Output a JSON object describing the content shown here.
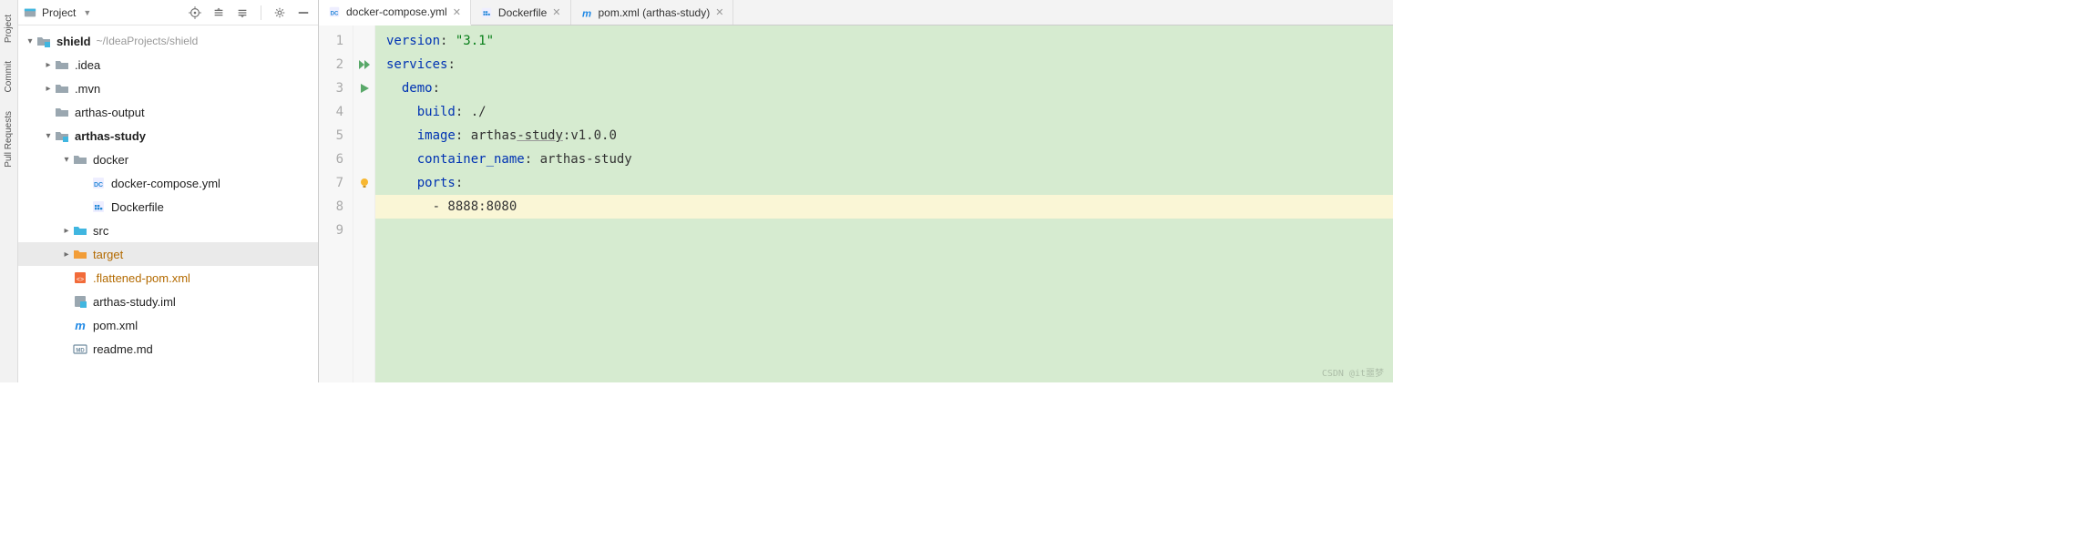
{
  "rail": {
    "top": "Project",
    "mid": "Commit",
    "bot": "Pull Requests"
  },
  "header": {
    "label": "Project"
  },
  "tree": {
    "root": {
      "name": "shield",
      "path": "~/IdeaProjects/shield"
    },
    "items": [
      {
        "name": ".idea",
        "indent": 1,
        "arrow": "right",
        "icon": "folder"
      },
      {
        "name": ".mvn",
        "indent": 1,
        "arrow": "right",
        "icon": "folder"
      },
      {
        "name": "arthas-output",
        "indent": 1,
        "arrow": "none",
        "icon": "folder"
      },
      {
        "name": "arthas-study",
        "indent": 1,
        "arrow": "down",
        "icon": "module",
        "bold": true
      },
      {
        "name": "docker",
        "indent": 2,
        "arrow": "down",
        "icon": "folder"
      },
      {
        "name": "docker-compose.yml",
        "indent": 3,
        "arrow": "none",
        "icon": "dc"
      },
      {
        "name": "Dockerfile",
        "indent": 3,
        "arrow": "none",
        "icon": "docker"
      },
      {
        "name": "src",
        "indent": 2,
        "arrow": "right",
        "icon": "src"
      },
      {
        "name": "target",
        "indent": 2,
        "arrow": "right",
        "icon": "target",
        "sel": true,
        "orange": true
      },
      {
        "name": ".flattened-pom.xml",
        "indent": 2,
        "arrow": "none",
        "icon": "xml",
        "orange": true
      },
      {
        "name": "arthas-study.iml",
        "indent": 2,
        "arrow": "none",
        "icon": "iml"
      },
      {
        "name": "pom.xml",
        "indent": 2,
        "arrow": "none",
        "icon": "maven"
      },
      {
        "name": "readme.md",
        "indent": 2,
        "arrow": "none",
        "icon": "md"
      }
    ]
  },
  "tabs": [
    {
      "label": "docker-compose.yml",
      "icon": "dc",
      "active": true
    },
    {
      "label": "Dockerfile",
      "icon": "docker"
    },
    {
      "label": "pom.xml (arthas-study)",
      "icon": "maven"
    }
  ],
  "code": {
    "lines": [
      {
        "n": 1,
        "marker": "",
        "segs": [
          [
            "kw",
            "version"
          ],
          [
            "id",
            ": "
          ],
          [
            "str",
            "\"3.1\""
          ]
        ]
      },
      {
        "n": 2,
        "marker": "run-all",
        "segs": [
          [
            "kw",
            "services"
          ],
          [
            "id",
            ":"
          ]
        ]
      },
      {
        "n": 3,
        "marker": "run",
        "segs": [
          [
            "id",
            "  "
          ],
          [
            "kw",
            "demo"
          ],
          [
            "id",
            ":"
          ]
        ]
      },
      {
        "n": 4,
        "marker": "",
        "segs": [
          [
            "id",
            "    "
          ],
          [
            "kw",
            "build"
          ],
          [
            "id",
            ": ./"
          ]
        ]
      },
      {
        "n": 5,
        "marker": "",
        "segs": [
          [
            "id",
            "    "
          ],
          [
            "kw",
            "image"
          ],
          [
            "id",
            ": arthas"
          ],
          [
            "under",
            "-study"
          ],
          [
            "id",
            ":v1.0.0"
          ]
        ]
      },
      {
        "n": 6,
        "marker": "",
        "segs": [
          [
            "id",
            "    "
          ],
          [
            "kw",
            "container_name"
          ],
          [
            "id",
            ": arthas-study"
          ]
        ]
      },
      {
        "n": 7,
        "marker": "bulb",
        "segs": [
          [
            "id",
            "    "
          ],
          [
            "kw",
            "ports"
          ],
          [
            "id",
            ":"
          ]
        ]
      },
      {
        "n": 8,
        "marker": "",
        "hl": true,
        "segs": [
          [
            "id",
            "      - 8888:8080"
          ]
        ]
      },
      {
        "n": 9,
        "marker": "",
        "segs": [
          [
            "id",
            ""
          ]
        ]
      }
    ]
  },
  "watermark": "CSDN @it噩梦"
}
